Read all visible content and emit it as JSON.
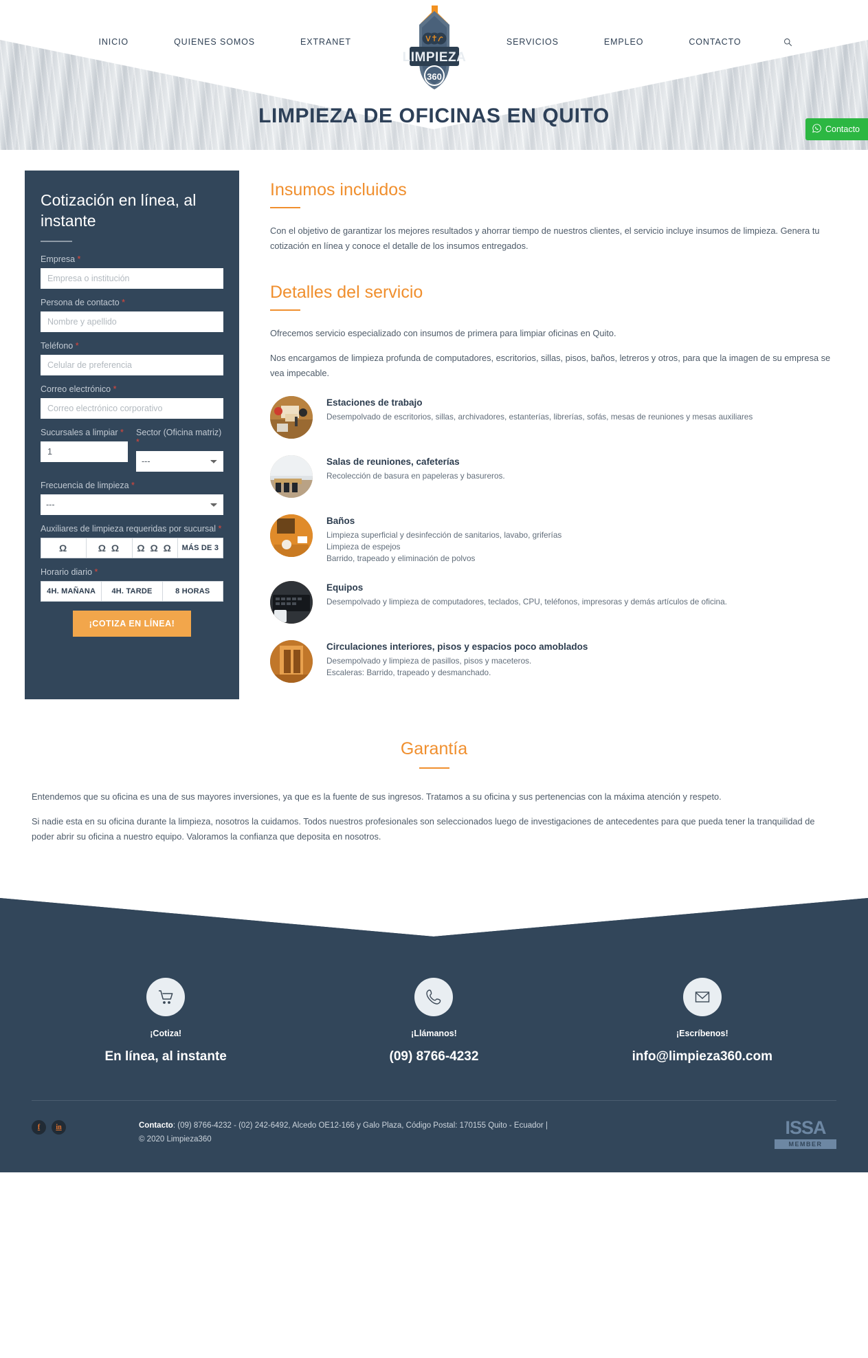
{
  "nav": {
    "left_items": [
      {
        "label": "INICIO"
      },
      {
        "label": "QUIENES SOMOS"
      },
      {
        "label": "EXTRANET"
      }
    ],
    "right_items": [
      {
        "label": "SERVICIOS"
      },
      {
        "label": "EMPLEO"
      },
      {
        "label": "CONTACTO"
      }
    ],
    "search_icon": "search-icon"
  },
  "logo": {
    "wordmark": "LIMPIEZA",
    "badge": "360"
  },
  "hero": {
    "title": "LIMPIEZA DE OFICINAS EN QUITO",
    "whatsapp_label": "Contacto",
    "whatsapp_icon": "whatsapp-icon"
  },
  "quote_form": {
    "title": "Cotización en línea, al instante",
    "fields": {
      "empresa": {
        "label": "Empresa",
        "required": "*",
        "placeholder": "Empresa o institución",
        "value": ""
      },
      "persona": {
        "label": "Persona de contacto",
        "required": "*",
        "placeholder": "Nombre y apellido",
        "value": ""
      },
      "telefono": {
        "label": "Teléfono",
        "required": "*",
        "placeholder": "Celular de preferencia",
        "value": ""
      },
      "correo": {
        "label": "Correo electrónico",
        "required": "*",
        "placeholder": "Correo electrónico corporativo",
        "value": ""
      },
      "sucursales": {
        "label": "Sucursales a limpiar",
        "required": "*",
        "value": "1"
      },
      "sector": {
        "label": "Sector (Oficina matriz)",
        "required": "*",
        "value": "---"
      },
      "frecuencia": {
        "label": "Frecuencia de limpieza",
        "required": "*",
        "value": "---"
      },
      "auxiliares": {
        "label": "Auxiliares de limpieza requeridas por sucursal",
        "required": "*"
      },
      "horario": {
        "label": "Horario diario",
        "required": "*"
      }
    },
    "auxiliares_options": [
      {
        "label": "Ω",
        "name": "one-person"
      },
      {
        "label": "Ω Ω",
        "name": "two-persons"
      },
      {
        "label": "Ω Ω Ω",
        "name": "three-persons"
      },
      {
        "label": "MÁS DE 3",
        "name": "more-than-three"
      }
    ],
    "horario_options": [
      {
        "label": "4H. MAÑANA"
      },
      {
        "label": "4H. TARDE"
      },
      {
        "label": "8 HORAS"
      }
    ],
    "submit_label": "¡COTIZA EN LÍNEA!"
  },
  "insumos": {
    "title": "Insumos incluidos",
    "paragraph": "Con el objetivo de garantizar los mejores resultados y ahorrar tiempo de nuestros clientes, el servicio incluye insumos de limpieza. Genera tu cotización en línea y conoce el detalle de los insumos entregados."
  },
  "detalles": {
    "title": "Detalles del servicio",
    "paragraph1": "Ofrecemos servicio especializado con insumos de primera para limpiar oficinas en Quito.",
    "paragraph2": "Nos encargamos de limpieza profunda de computadores, escritorios, sillas, pisos, baños, letreros y otros, para que la imagen de su empresa se vea impecable.",
    "services": [
      {
        "name": "Estaciones de trabajo",
        "desc": "Desempolvado de escritorios, sillas, archivadores, estanterías, librerías, sofás, mesas de reuniones y mesas auxiliares",
        "thumb": "workstation-photo"
      },
      {
        "name": "Salas de reuniones, cafeterías",
        "desc": "Recolección de basura en papeleras y basureros.",
        "thumb": "meeting-room-photo"
      },
      {
        "name": "Baños",
        "desc": "Limpieza superficial y desinfección de sanitarios, lavabo, griferías\nLimpieza de espejos\nBarrido, trapeado y eliminación de polvos",
        "thumb": "bathroom-photo"
      },
      {
        "name": "Equipos",
        "desc": "Desempolvado y limpieza de computadores, teclados, CPU, teléfonos, impresoras y demás artículos de oficina.",
        "thumb": "equipment-photo"
      },
      {
        "name": "Circulaciones interiores, pisos y espacios poco amoblados",
        "desc": "Desempolvado y limpieza de pasillos, pisos y maceteros.\nEscaleras: Barrido, trapeado y desmanchado.",
        "thumb": "corridor-photo"
      }
    ]
  },
  "garantia": {
    "title": "Garantía",
    "paragraph1": "Entendemos que su oficina es una de sus mayores inversiones, ya que es la fuente de sus ingresos. Tratamos a su oficina y sus pertenencias con la máxima atención y respeto.",
    "paragraph2": "Si nadie esta en su oficina durante la limpieza, nosotros la cuidamos. Todos nuestros profesionales son seleccionados luego de investigaciones de antecedentes para que pueda tener la tranquilidad de poder abrir su oficina a nuestro equipo. Valoramos la confianza que deposita en nosotros."
  },
  "footer": {
    "contacts": [
      {
        "icon": "cart-icon",
        "label": "¡Cotiza!",
        "value": "En línea, al instante"
      },
      {
        "icon": "phone-icon",
        "label": "¡Llámanos!",
        "value": "(09) 8766-4232"
      },
      {
        "icon": "envelope-icon",
        "label": "¡Escríbenos!",
        "value": "info@limpieza360.com"
      }
    ],
    "social": [
      {
        "glyph": "f",
        "name": "facebook-icon"
      },
      {
        "glyph": "in",
        "name": "linkedin-icon"
      }
    ],
    "contact_label": "Contacto",
    "contact_line": ": (09) 8766-4232 - (02) 242-6492, Alcedo OE12-166 y Galo Plaza, Código Postal: 170155 Quito - Ecuador  |",
    "copyright": "© 2020  Limpieza360",
    "issa_logo": "ISSA",
    "issa_member": "MEMBER"
  }
}
